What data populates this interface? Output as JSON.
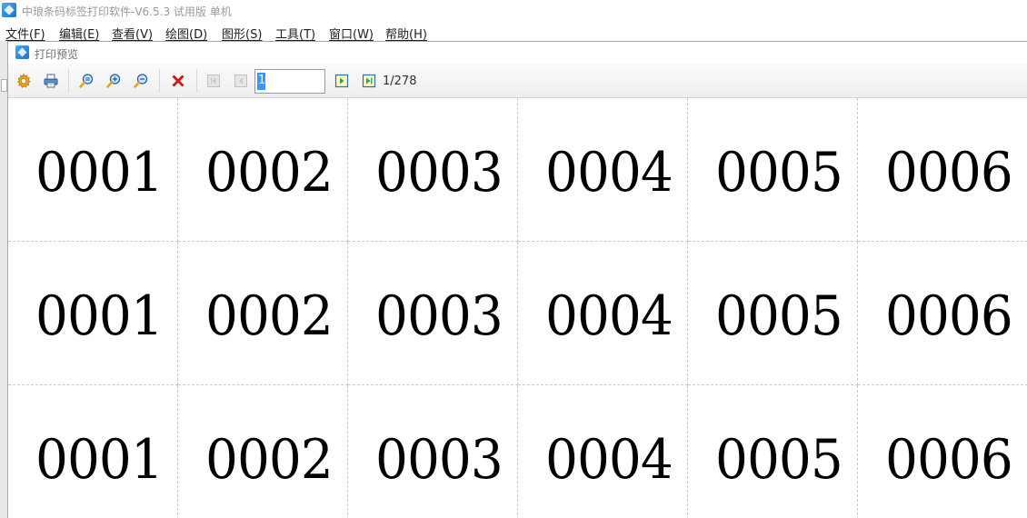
{
  "app": {
    "title": "中琅条码标签打印软件-V6.5.3 试用版 单机"
  },
  "menubar": {
    "items": [
      {
        "label": "文件(F)"
      },
      {
        "label": "编辑(E)"
      },
      {
        "label": "查看(V)"
      },
      {
        "label": "绘图(D)"
      },
      {
        "label": "图形(S)"
      },
      {
        "label": "工具(T)"
      },
      {
        "label": "窗口(W)"
      },
      {
        "label": "帮助(H)"
      }
    ]
  },
  "preview": {
    "title": "打印预览",
    "toolbar": {
      "buttons": [
        {
          "name": "settings-gear-icon"
        },
        {
          "name": "printer-icon"
        },
        {
          "name": "zoom-fit-icon"
        },
        {
          "name": "zoom-in-icon"
        },
        {
          "name": "zoom-out-icon"
        },
        {
          "name": "close-x-icon"
        },
        {
          "name": "first-page-icon"
        },
        {
          "name": "prev-page-icon"
        },
        {
          "name": "next-page-icon"
        },
        {
          "name": "last-page-icon"
        }
      ],
      "page_input_value": "1",
      "page_count_text": "1/278"
    },
    "labels": {
      "rows": [
        [
          "0001",
          "0002",
          "0003",
          "0004",
          "0005",
          "0006"
        ],
        [
          "0001",
          "0002",
          "0003",
          "0004",
          "0005",
          "0006"
        ],
        [
          "0001",
          "0002",
          "0003",
          "0004",
          "0005",
          "0006"
        ]
      ]
    }
  },
  "colors": {
    "accent_blue": "#1e73c8",
    "selection": "#3399ff",
    "close_red": "#e02020",
    "nav_green": "#2ea84f"
  }
}
